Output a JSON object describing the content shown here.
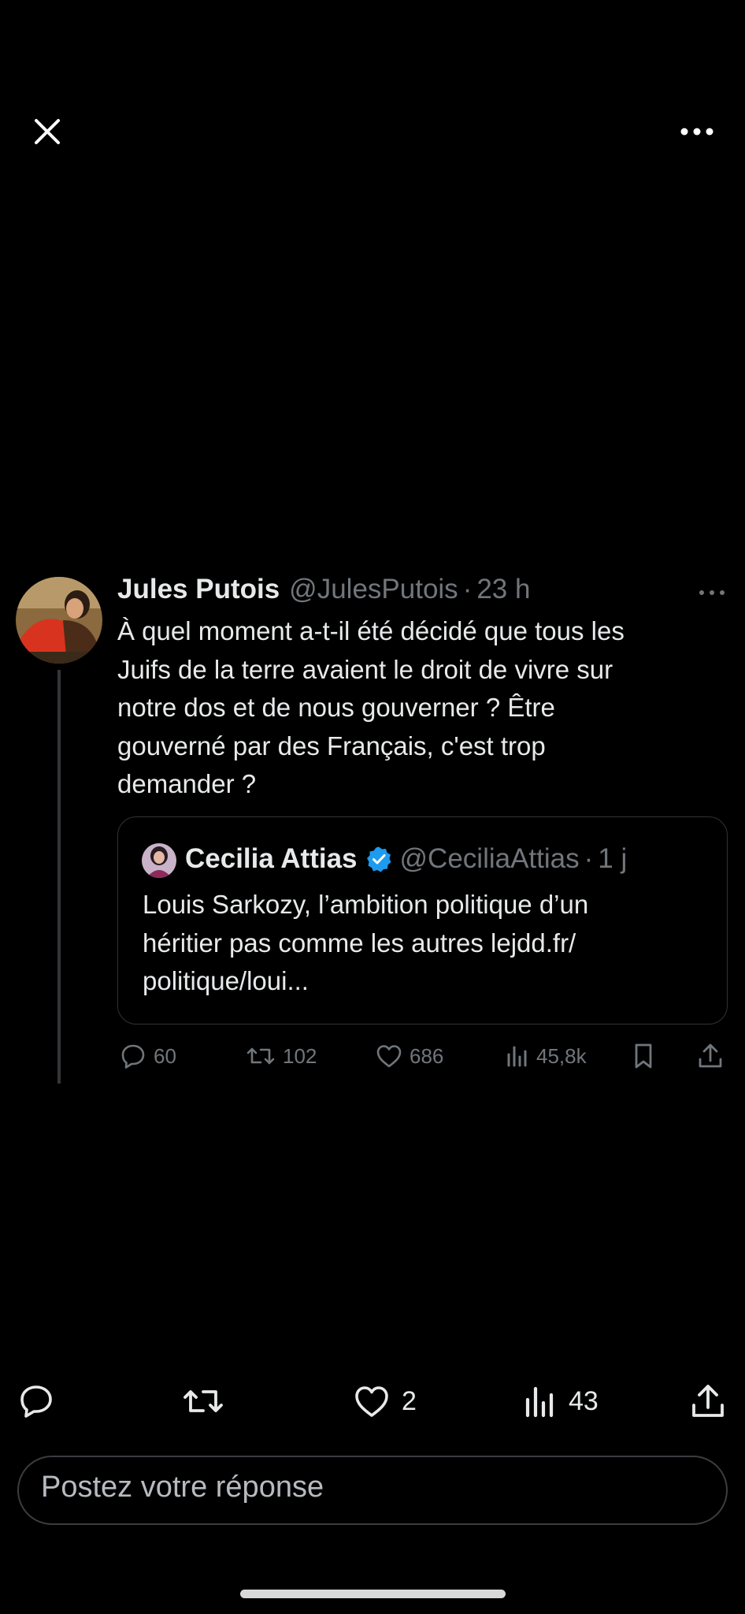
{
  "header": {
    "close_icon": "close-icon",
    "more_icon": "more-horizontal-icon"
  },
  "tweet": {
    "display_name": "Jules Putois",
    "handle": "@JulesPutois",
    "separator": "·",
    "time": "23 h",
    "lines": [
      "À quel moment a-t-il été décidé que tous les",
      "Juifs de la terre avaient le droit de vivre sur",
      "notre dos et de nous gouverner ? Être",
      "gouverné par des Français, c'est trop",
      "demander ?"
    ],
    "quote": {
      "display_name": "Cecilia Attias",
      "verified": true,
      "handle": "@CeciliaAttias",
      "separator": "·",
      "time": "1 j",
      "lines": [
        "Louis Sarkozy, l’ambition politique d’un",
        "héritier pas comme les autres lejdd.fr/",
        "politique/loui..."
      ]
    },
    "stats": {
      "replies": "60",
      "retweets": "102",
      "likes": "686",
      "views": "45,8k"
    }
  },
  "bottom_bar": {
    "likes": "2",
    "views": "43"
  },
  "reply": {
    "placeholder": "Postez votre réponse"
  },
  "colors": {
    "background": "#000000",
    "text": "#e7e9ea",
    "secondary": "#71767b",
    "verified": "#1d9bf0",
    "border": "#2f3336"
  }
}
